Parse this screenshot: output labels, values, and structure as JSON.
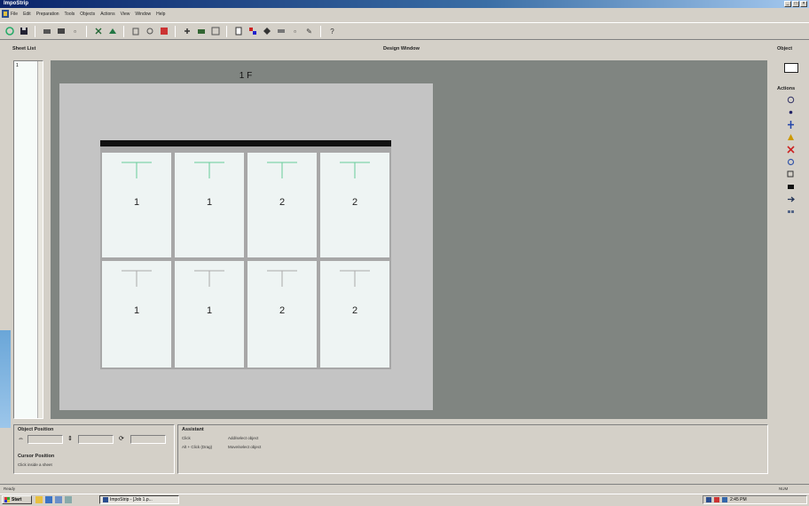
{
  "window": {
    "title": "ImpoStrip"
  },
  "menu": [
    "File",
    "Edit",
    "Preparation",
    "Tools",
    "Objects",
    "Actions",
    "View",
    "Window",
    "Help"
  ],
  "panels": {
    "sheet_list": "Sheet List",
    "design_window": "Design Window",
    "object": "Object",
    "actions": "Actions",
    "object_position": "Object Position",
    "cursor_position": "Cursor Position",
    "assistant": "Assistant"
  },
  "sheet_list": {
    "items": [
      "1"
    ]
  },
  "sheet": {
    "title": "1 F",
    "pages_row1": [
      "1",
      "1",
      "2",
      "2"
    ],
    "pages_row2": [
      "1",
      "1",
      "2",
      "2"
    ]
  },
  "cursor_position": {
    "text": "Click inside a sheet"
  },
  "assistant": {
    "rows": [
      {
        "key": "Click",
        "value": "Add/select object"
      },
      {
        "key": "Alt + Click (Drag)",
        "value": "Move/select object"
      }
    ]
  },
  "status": {
    "left": "Ready",
    "right": "NUM"
  },
  "taskbar": {
    "start": "Start",
    "task": "ImpoStrip - [Job 1.p...",
    "tray_time": "2:45 PM"
  },
  "toolbar_icons": [
    "new-icon",
    "open-icon",
    "save-icon",
    "print-icon",
    "preview-icon",
    "cut-icon",
    "copy-icon",
    "paste-icon",
    "delete-icon",
    "zoom-in-icon",
    "zoom-out-icon",
    "fit-icon",
    "grid-icon",
    "layer-icon",
    "rotate-icon",
    "flip-icon",
    "color-icon",
    "help-icon"
  ],
  "action_icons": [
    "rotate-icon",
    "point-icon",
    "distribute-icon",
    "color-mark-icon",
    "delete-mark-icon",
    "link-icon",
    "copy-mark-icon",
    "fill-icon",
    "move-icon",
    "group-icon"
  ]
}
